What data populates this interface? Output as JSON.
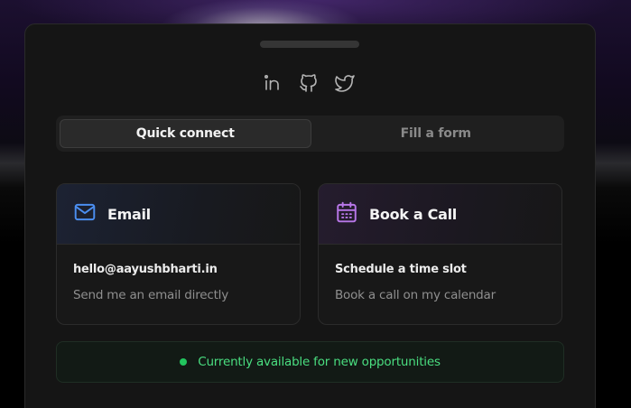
{
  "socials": [
    {
      "icon": "linkedin-icon"
    },
    {
      "icon": "github-icon"
    },
    {
      "icon": "twitter-icon"
    }
  ],
  "tabs": [
    {
      "label": "Quick connect",
      "active": true
    },
    {
      "label": "Fill a form",
      "active": false
    }
  ],
  "cards": {
    "email": {
      "icon": "mail-icon",
      "title": "Email",
      "main": "hello@aayushbharti.in",
      "sub": "Send me an email directly",
      "accent": "#4b8ef0"
    },
    "call": {
      "icon": "calendar-icon",
      "title": "Book a Call",
      "main": "Schedule a time slot",
      "sub": "Book a call on my calendar",
      "accent": "#b877e8"
    }
  },
  "status": {
    "text": "Currently available for new opportunities",
    "color": "#22c55e"
  }
}
